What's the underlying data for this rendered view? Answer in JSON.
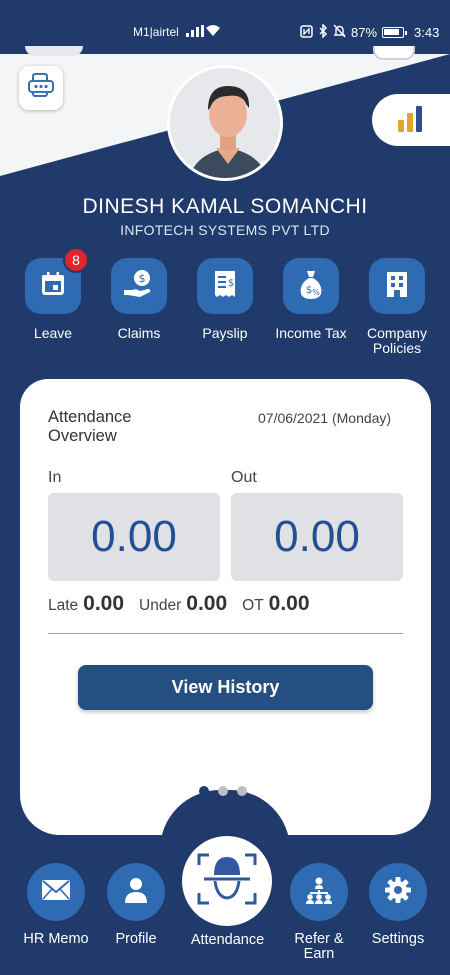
{
  "status_bar": {
    "carrier": "M1|airtel",
    "battery": "87%",
    "time": "3:43"
  },
  "profile": {
    "name": "DINESH KAMAL SOMANCHI",
    "company": "INFOTECH SYSTEMS PVT LTD"
  },
  "quick_actions": [
    {
      "label": "Leave",
      "icon": "calendar-icon",
      "badge": "8"
    },
    {
      "label": "Claims",
      "icon": "hand-coin-icon"
    },
    {
      "label": "Payslip",
      "icon": "receipt-icon"
    },
    {
      "label": "Income Tax",
      "icon": "money-bag-icon"
    },
    {
      "label": "Company Policies",
      "icon": "building-icon"
    }
  ],
  "attendance": {
    "title": "Attendance Overview",
    "date": "07/06/2021 (Monday)",
    "in_label": "In",
    "in_value": "0.00",
    "out_label": "Out",
    "out_value": "0.00",
    "late_label": "Late",
    "late_value": "0.00",
    "under_label": "Under",
    "under_value": "0.00",
    "ot_label": "OT",
    "ot_value": "0.00",
    "view_history": "View History",
    "pager": {
      "pages": 3,
      "active": 1
    }
  },
  "bottom_nav": [
    {
      "label": "HR Memo",
      "icon": "envelope-icon"
    },
    {
      "label": "Profile",
      "icon": "person-icon"
    },
    {
      "label": "Attendance",
      "icon": "face-scan-icon"
    },
    {
      "label": "Refer & Earn",
      "icon": "network-icon"
    },
    {
      "label": "Settings",
      "icon": "gear-icon"
    }
  ],
  "colors": {
    "primary_dark": "#1f3a6b",
    "icon_blue": "#2f6bb3",
    "button": "#244f80",
    "badge": "#e0242b",
    "value_text": "#244f97"
  }
}
